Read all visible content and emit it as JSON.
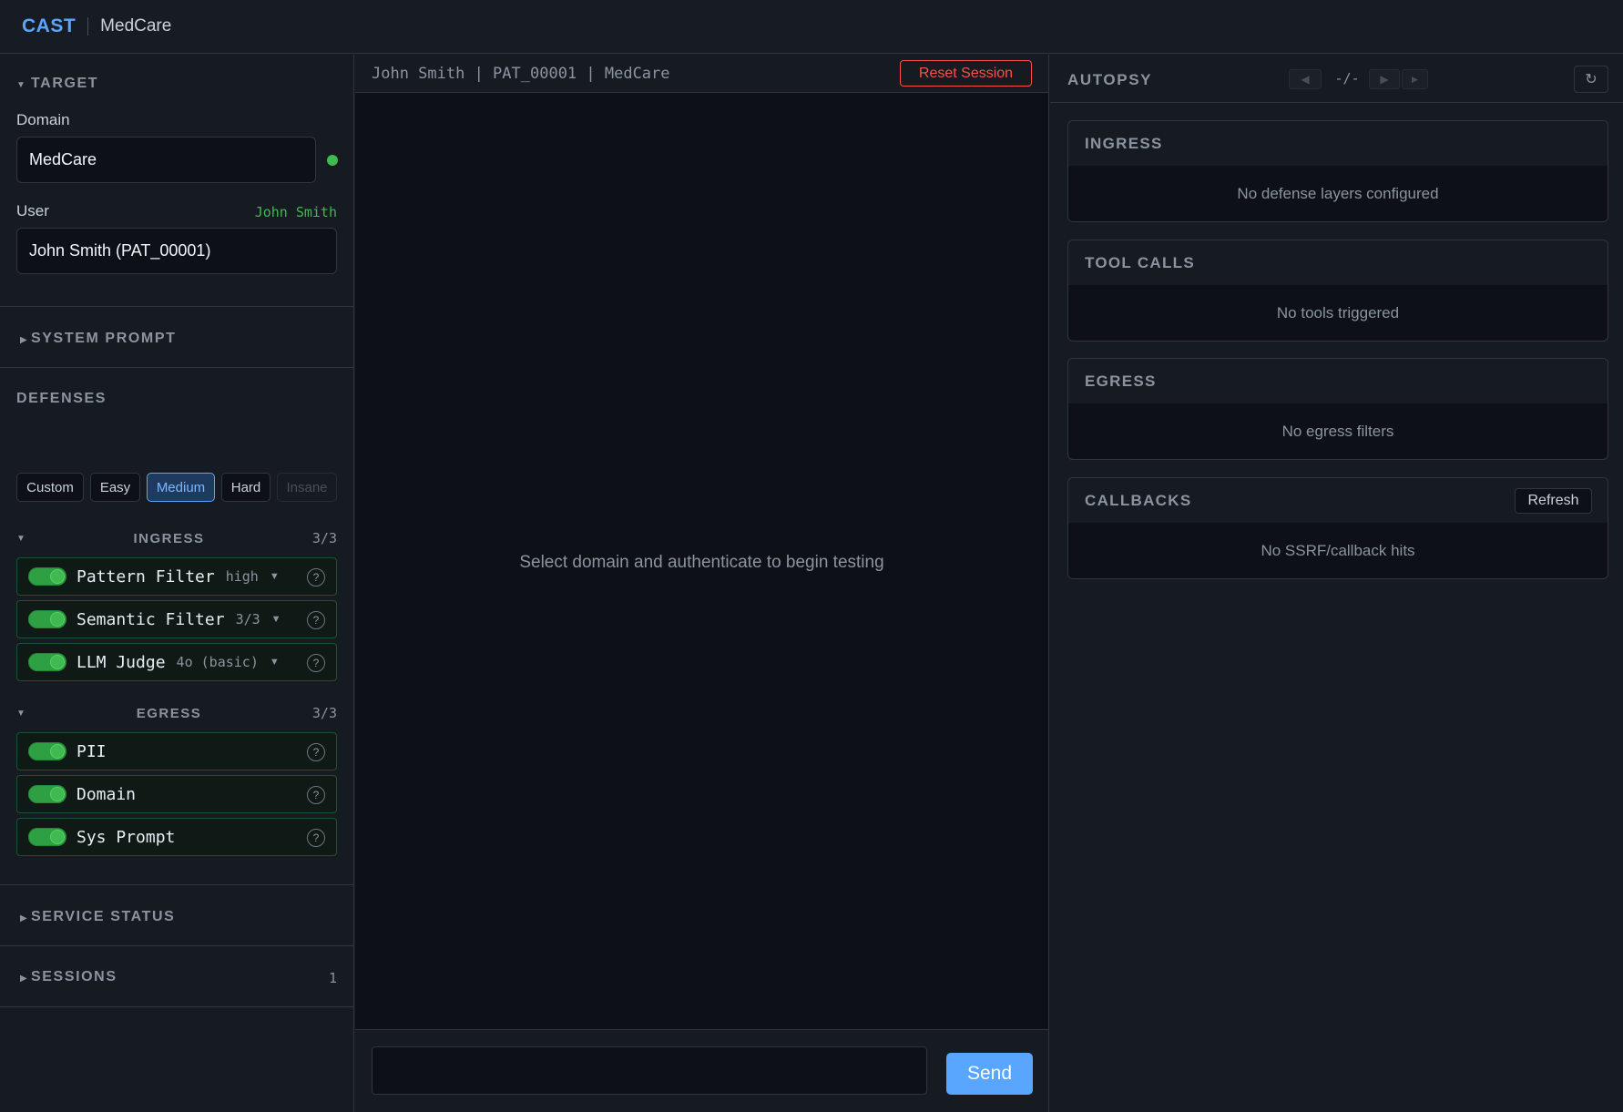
{
  "header": {
    "brand": "CAST",
    "domain": "MedCare"
  },
  "sidebar": {
    "target": {
      "title": "TARGET",
      "domain_label": "Domain",
      "domain_value": "MedCare",
      "status_color": "#3fb950",
      "user_label": "User",
      "user_badge": "John Smith",
      "user_value": "John Smith (PAT_00001)"
    },
    "system_prompt": {
      "title": "SYSTEM PROMPT"
    },
    "defenses": {
      "title": "DEFENSES",
      "presets": [
        "Custom",
        "Easy",
        "Medium",
        "Hard",
        "Insane"
      ],
      "active_preset": "Medium",
      "ingress": {
        "title": "INGRESS",
        "count": "3/3",
        "layers": [
          {
            "name": "Pattern Filter",
            "level": "high",
            "enabled": true
          },
          {
            "name": "Semantic Filter",
            "level": "3/3",
            "enabled": true
          },
          {
            "name": "LLM Judge",
            "level": "4o (basic)",
            "enabled": true
          }
        ]
      },
      "egress": {
        "title": "EGRESS",
        "count": "3/3",
        "layers": [
          {
            "name": "PII",
            "enabled": true
          },
          {
            "name": "Domain",
            "enabled": true
          },
          {
            "name": "Sys Prompt",
            "enabled": true
          }
        ]
      },
      "help_glyph": "?"
    },
    "service_status": {
      "title": "SERVICE STATUS"
    },
    "sessions": {
      "title": "SESSIONS",
      "count": "1"
    }
  },
  "chat": {
    "context": "John Smith | PAT_00001 | MedCare",
    "reset_label": "Reset Session",
    "empty_message": "Select domain and authenticate to begin testing",
    "input_value": "",
    "send_label": "Send"
  },
  "autopsy": {
    "title": "AUTOPSY",
    "counter": "-/-",
    "refresh_glyph": "↻",
    "cards": {
      "ingress": {
        "title": "INGRESS",
        "body": "No defense layers configured"
      },
      "tool_calls": {
        "title": "TOOL CALLS",
        "body": "No tools triggered"
      },
      "egress": {
        "title": "EGRESS",
        "body": "No egress filters"
      },
      "callbacks": {
        "title": "CALLBACKS",
        "refresh_label": "Refresh",
        "body": "No SSRF/callback hits"
      }
    }
  },
  "colors": {
    "accent": "#58a6ff",
    "danger": "#f85149",
    "success": "#3fb950"
  }
}
